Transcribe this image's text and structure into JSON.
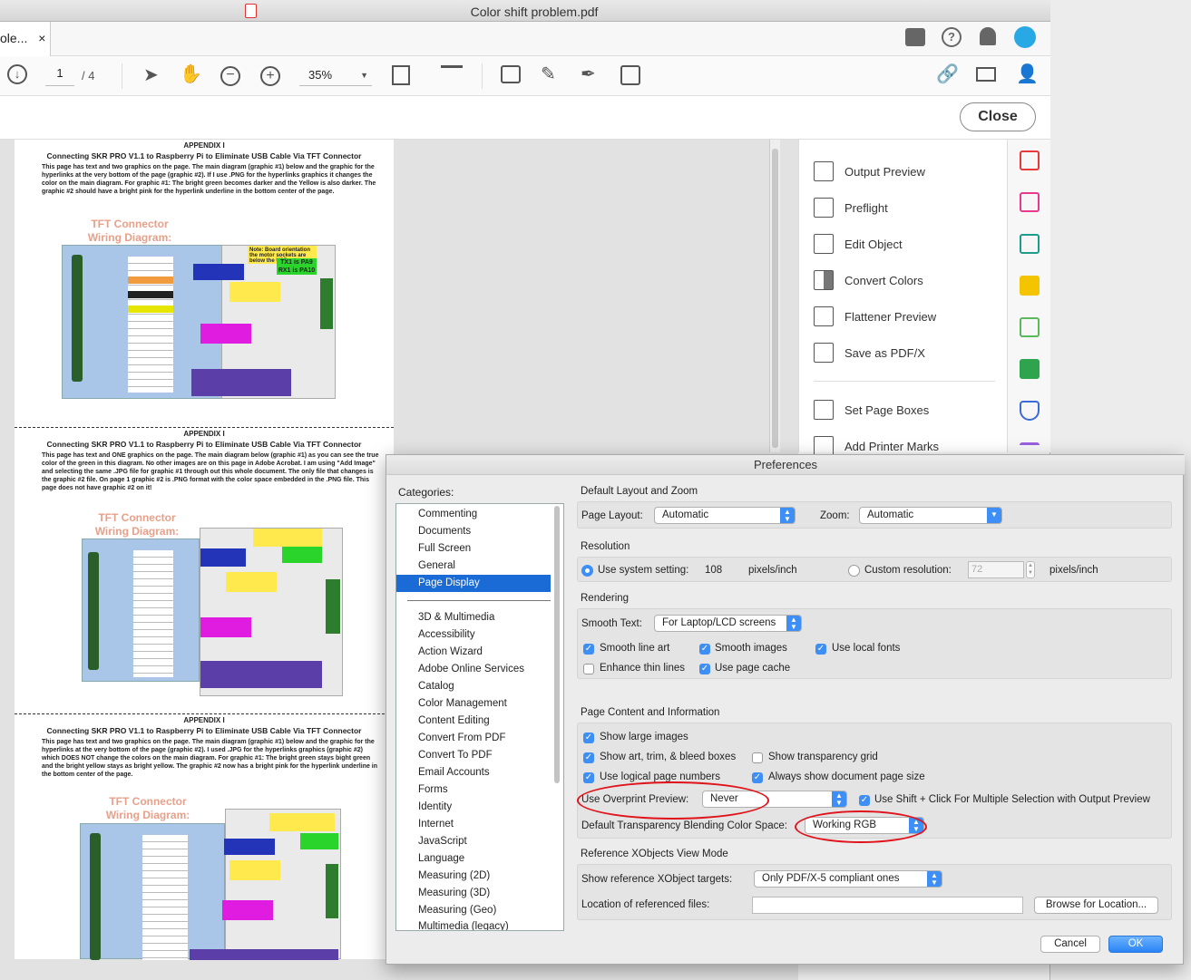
{
  "window": {
    "title": "Color shift problem.pdf",
    "tab_label": "ole...",
    "tab_close": "×"
  },
  "toolbar": {
    "page_current": "1",
    "page_total": "/ 4",
    "zoom": "35%"
  },
  "toolbar2": {
    "close_label": "Close"
  },
  "pdf": {
    "appendix": "APPENDIX I",
    "heading": "Connecting SKR PRO V1.1 to Raspberry Pi to Eliminate USB Cable Via TFT Connector",
    "p1": "This page has text and two graphics on the page.  The main diagram (graphic #1) below and the graphic for the hyperlinks at the very bottom of the page (graphic #2).  If I use .PNG for the hyperlinks graphics it changes the color on the main diagram.  For graphic #1: The bright green becomes darker and the Yellow is also darker.   The graphic #2 should have a bright pink for the hyperlink underline in the bottom center of the page.",
    "p2": "This page has text and ONE graphics on the page.  The main diagram below (graphic #1) as you can see the true color of the green in this diagram.  No other images are on this page in Adobe Acrobat. I am using \"Add Image\" and selecting the same .JPG file for graphic #1 through out this whole document.  The only file that changes is the graphic #2 file. On page 1 graphic #2 is .PNG format with the color space embedded in the .PNG file. This page does not have graphic #2 on it!",
    "p3": "This page has text and two graphics on the page.  The main diagram (graphic #1) below and the graphic for the hyperlinks at the very bottom of the page (graphic #2).  I used .JPG for the hyperlinks graphics (graphic #2) which DOES NOT change the colors on the main diagram. For graphic #1: The bright green stays bight green and the bright yellow stays as bright yellow.  The graphic #2 now has a bright pink for the hyperlink underline in the bottom center of the page.",
    "tft": "TFT Connector",
    "wiring": "Wiring Diagram:",
    "tx1": "TX1 is PA9",
    "rx1": "RX1 is PA10",
    "note_board": "Note: Board orientation the motor sockets are below the USB ports"
  },
  "right_panel": {
    "items": [
      "Output Preview",
      "Preflight",
      "Edit Object",
      "Convert Colors",
      "Flattener Preview",
      "Save as PDF/X",
      "Set Page Boxes",
      "Add Printer Marks"
    ]
  },
  "prefs": {
    "title": "Preferences",
    "categories_label": "Categories:",
    "categories_top": [
      "Commenting",
      "Documents",
      "Full Screen",
      "General",
      "Page Display"
    ],
    "categories": [
      "3D & Multimedia",
      "Accessibility",
      "Action Wizard",
      "Adobe Online Services",
      "Catalog",
      "Color Management",
      "Content Editing",
      "Convert From PDF",
      "Convert To PDF",
      "Email Accounts",
      "Forms",
      "Identity",
      "Internet",
      "JavaScript",
      "Language",
      "Measuring (2D)",
      "Measuring (3D)",
      "Measuring (Geo)",
      "Multimedia (legacy)"
    ],
    "layout_zoom": {
      "title": "Default Layout and Zoom",
      "page_layout_label": "Page Layout:",
      "page_layout": "Automatic",
      "zoom_label": "Zoom:",
      "zoom": "Automatic"
    },
    "resolution": {
      "title": "Resolution",
      "system_label": "Use system setting:",
      "system_value": "108",
      "unit": "pixels/inch",
      "custom_label": "Custom resolution:",
      "custom_value": "72",
      "custom_unit": "pixels/inch"
    },
    "rendering": {
      "title": "Rendering",
      "smooth_text_label": "Smooth Text:",
      "smooth_text": "For Laptop/LCD screens",
      "smooth_line_art": "Smooth line art",
      "smooth_images": "Smooth images",
      "use_local_fonts": "Use local fonts",
      "enhance_thin": "Enhance thin lines",
      "use_page_cache": "Use page cache"
    },
    "content": {
      "title": "Page Content and Information",
      "show_large_images": "Show large images",
      "show_art_trim": "Show art, trim, & bleed boxes",
      "show_transparency": "Show transparency grid",
      "use_logical": "Use logical page numbers",
      "always_show": "Always show document page size",
      "overprint_label": "Use Overprint Preview:",
      "overprint": "Never",
      "shift_click": "Use Shift + Click For Multiple Selection with Output Preview",
      "blend_label": "Default Transparency Blending Color Space:",
      "blend": "Working RGB"
    },
    "xobjects": {
      "title": "Reference XObjects View Mode",
      "targets_label": "Show reference XObject targets:",
      "targets": "Only PDF/X-5 compliant ones",
      "location_label": "Location of referenced files:",
      "browse": "Browse for Location..."
    },
    "cancel": "Cancel",
    "ok": "OK"
  }
}
